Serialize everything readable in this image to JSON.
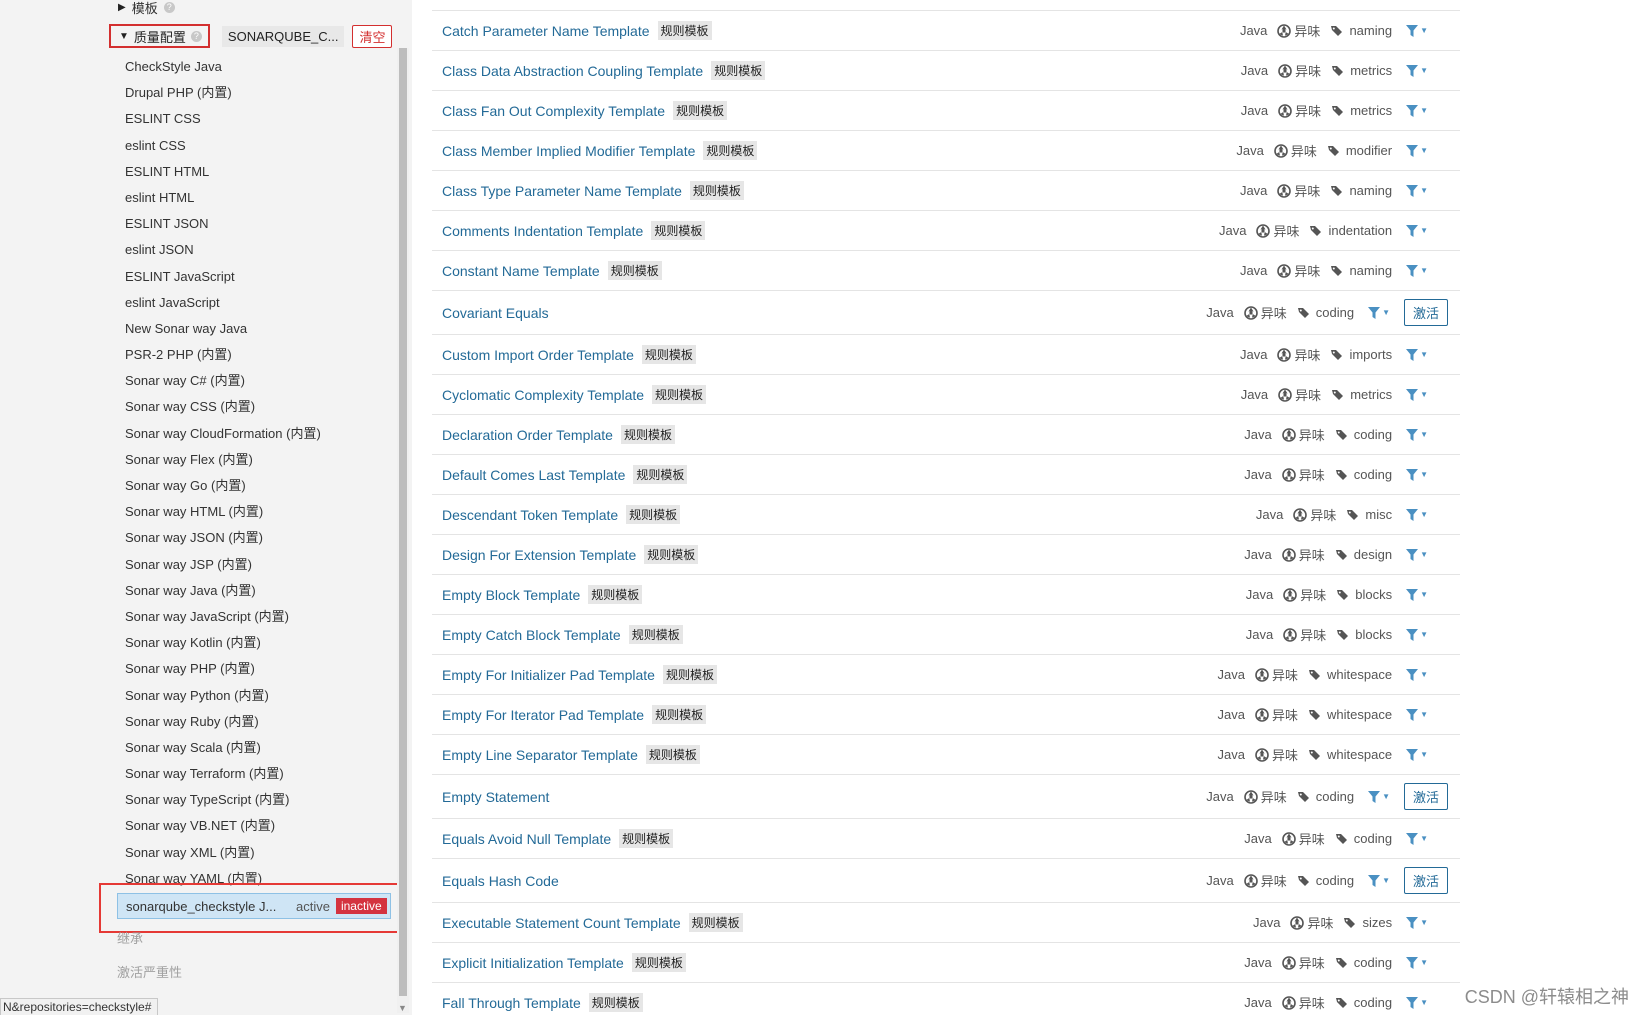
{
  "sidebar": {
    "templates_facet_label": "模板",
    "quality_profile_facet": {
      "label": "质量配置",
      "selected_chip": "SONARQUBE_C...",
      "clear_label": "清空"
    },
    "profiles": [
      "CheckStyle Java",
      "Drupal PHP (内置)",
      "ESLINT CSS",
      "eslint CSS",
      "ESLINT HTML",
      "eslint HTML",
      "ESLINT JSON",
      "eslint JSON",
      "ESLINT JavaScript",
      "eslint JavaScript",
      "New Sonar way Java",
      "PSR-2 PHP (内置)",
      "Sonar way C# (内置)",
      "Sonar way CSS (内置)",
      "Sonar way CloudFormation (内置)",
      "Sonar way Flex (内置)",
      "Sonar way Go (内置)",
      "Sonar way HTML (内置)",
      "Sonar way JSON (内置)",
      "Sonar way JSP (内置)",
      "Sonar way Java (内置)",
      "Sonar way JavaScript (内置)",
      "Sonar way Kotlin (内置)",
      "Sonar way PHP (内置)",
      "Sonar way Python (内置)",
      "Sonar way Ruby (内置)",
      "Sonar way Scala (内置)",
      "Sonar way Terraform (内置)",
      "Sonar way TypeScript (内置)",
      "Sonar way VB.NET (内置)",
      "Sonar way XML (内置)",
      "Sonar way YAML (内置)"
    ],
    "selected_profile": {
      "name": "sonarqube_checkstyle J...",
      "active_label": "active",
      "inactive_label": "inactive"
    },
    "inheritance_facet_label": "继承",
    "activation_severity_facet_label": "激活严重性",
    "status_url": "N&repositories=checkstyle#"
  },
  "rules": [
    {
      "name": "Catch Parameter Name Template",
      "template_badge": "规则模板",
      "language": "Java",
      "type": "异味",
      "tag": "naming"
    },
    {
      "name": "Class Data Abstraction Coupling Template",
      "template_badge": "规则模板",
      "language": "Java",
      "type": "异味",
      "tag": "metrics"
    },
    {
      "name": "Class Fan Out Complexity Template",
      "template_badge": "规则模板",
      "language": "Java",
      "type": "异味",
      "tag": "metrics"
    },
    {
      "name": "Class Member Implied Modifier Template",
      "template_badge": "规则模板",
      "language": "Java",
      "type": "异味",
      "tag": "modifier"
    },
    {
      "name": "Class Type Parameter Name Template",
      "template_badge": "规则模板",
      "language": "Java",
      "type": "异味",
      "tag": "naming"
    },
    {
      "name": "Comments Indentation Template",
      "template_badge": "规则模板",
      "language": "Java",
      "type": "异味",
      "tag": "indentation"
    },
    {
      "name": "Constant Name Template",
      "template_badge": "规则模板",
      "language": "Java",
      "type": "异味",
      "tag": "naming"
    },
    {
      "name": "Covariant Equals",
      "template_badge": "",
      "language": "Java",
      "type": "异味",
      "tag": "coding",
      "activate_label": "激活"
    },
    {
      "name": "Custom Import Order Template",
      "template_badge": "规则模板",
      "language": "Java",
      "type": "异味",
      "tag": "imports"
    },
    {
      "name": "Cyclomatic Complexity Template",
      "template_badge": "规则模板",
      "language": "Java",
      "type": "异味",
      "tag": "metrics"
    },
    {
      "name": "Declaration Order Template",
      "template_badge": "规则模板",
      "language": "Java",
      "type": "异味",
      "tag": "coding"
    },
    {
      "name": "Default Comes Last Template",
      "template_badge": "规则模板",
      "language": "Java",
      "type": "异味",
      "tag": "coding"
    },
    {
      "name": "Descendant Token Template",
      "template_badge": "规则模板",
      "language": "Java",
      "type": "异味",
      "tag": "misc"
    },
    {
      "name": "Design For Extension Template",
      "template_badge": "规则模板",
      "language": "Java",
      "type": "异味",
      "tag": "design"
    },
    {
      "name": "Empty Block Template",
      "template_badge": "规则模板",
      "language": "Java",
      "type": "异味",
      "tag": "blocks"
    },
    {
      "name": "Empty Catch Block Template",
      "template_badge": "规则模板",
      "language": "Java",
      "type": "异味",
      "tag": "blocks"
    },
    {
      "name": "Empty For Initializer Pad Template",
      "template_badge": "规则模板",
      "language": "Java",
      "type": "异味",
      "tag": "whitespace"
    },
    {
      "name": "Empty For Iterator Pad Template",
      "template_badge": "规则模板",
      "language": "Java",
      "type": "异味",
      "tag": "whitespace"
    },
    {
      "name": "Empty Line Separator Template",
      "template_badge": "规则模板",
      "language": "Java",
      "type": "异味",
      "tag": "whitespace"
    },
    {
      "name": "Empty Statement",
      "template_badge": "",
      "language": "Java",
      "type": "异味",
      "tag": "coding",
      "activate_label": "激活"
    },
    {
      "name": "Equals Avoid Null Template",
      "template_badge": "规则模板",
      "language": "Java",
      "type": "异味",
      "tag": "coding"
    },
    {
      "name": "Equals Hash Code",
      "template_badge": "",
      "language": "Java",
      "type": "异味",
      "tag": "coding",
      "activate_label": "激活"
    },
    {
      "name": "Executable Statement Count Template",
      "template_badge": "规则模板",
      "language": "Java",
      "type": "异味",
      "tag": "sizes"
    },
    {
      "name": "Explicit Initialization Template",
      "template_badge": "规则模板",
      "language": "Java",
      "type": "异味",
      "tag": "coding"
    },
    {
      "name": "Fall Through Template",
      "template_badge": "规则模板",
      "language": "Java",
      "type": "异味",
      "tag": "coding"
    }
  ],
  "watermark": "CSDN @轩辕相之神",
  "colors": {
    "link": "#236a97",
    "danger": "#d4333f",
    "selected_bg": "#cfe5f5",
    "filter_icon": "#4a90c2"
  }
}
